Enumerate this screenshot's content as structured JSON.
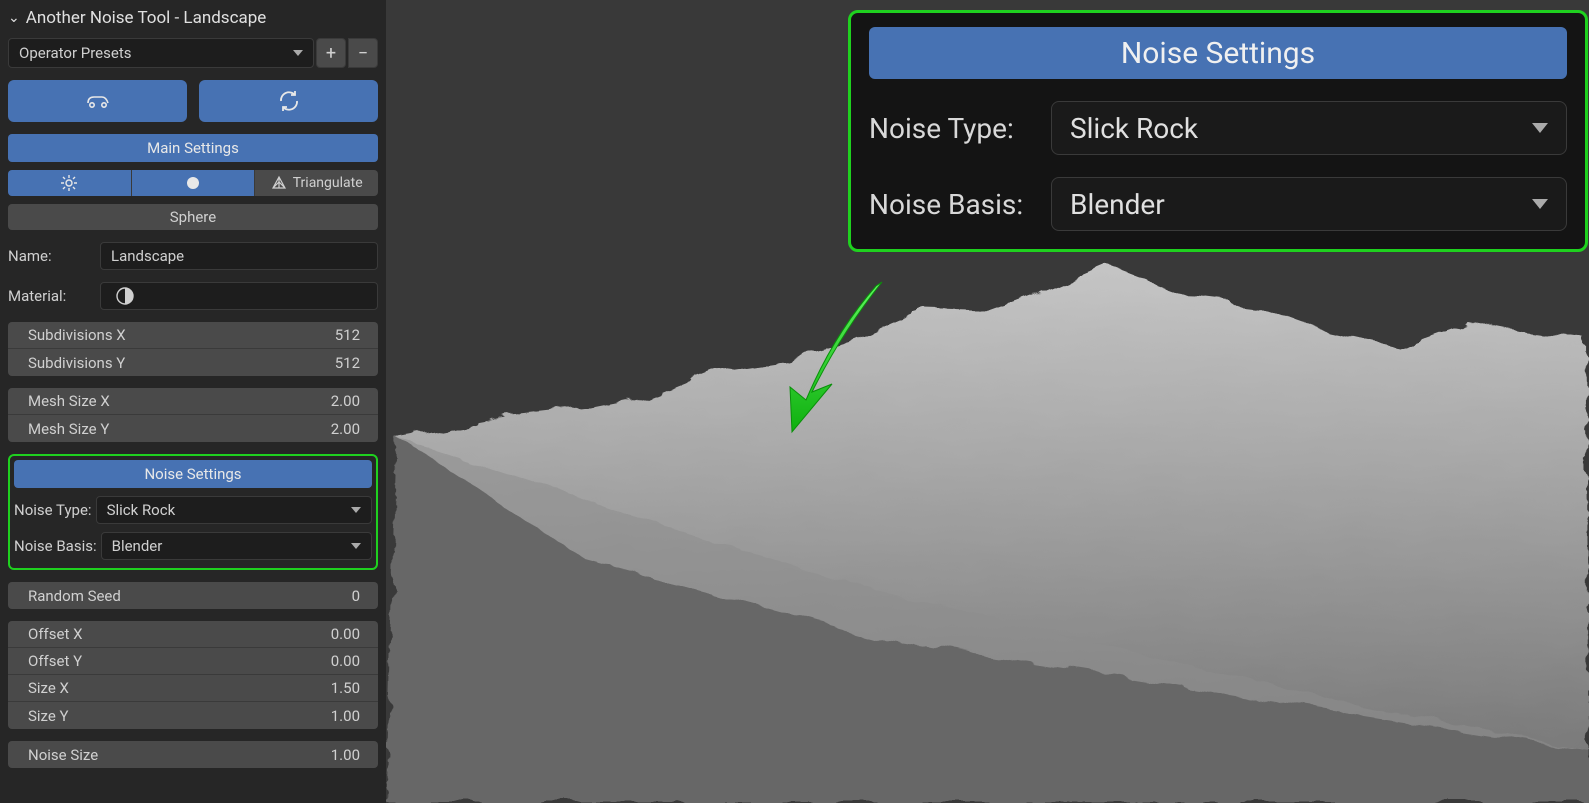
{
  "panel": {
    "title": "Another Noise Tool - Landscape"
  },
  "presets": {
    "label": "Operator Presets",
    "add": "+",
    "remove": "−"
  },
  "main": {
    "header": "Main Settings",
    "triangulate": "Triangulate",
    "sphere": "Sphere",
    "name_label": "Name:",
    "name_value": "Landscape",
    "material_label": "Material:"
  },
  "subdiv": {
    "x_label": "Subdivisions X",
    "x_value": "512",
    "y_label": "Subdivisions Y",
    "y_value": "512"
  },
  "mesh": {
    "x_label": "Mesh Size X",
    "x_value": "2.00",
    "y_label": "Mesh Size Y",
    "y_value": "2.00"
  },
  "noise": {
    "header": "Noise Settings",
    "type_label": "Noise Type:",
    "type_value": "Slick Rock",
    "basis_label": "Noise Basis:",
    "basis_value": "Blender"
  },
  "seed": {
    "label": "Random Seed",
    "value": "0"
  },
  "offset": {
    "x_label": "Offset X",
    "x_value": "0.00",
    "y_label": "Offset Y",
    "y_value": "0.00",
    "sx_label": "Size X",
    "sx_value": "1.50",
    "sy_label": "Size Y",
    "sy_value": "1.00"
  },
  "nsize": {
    "label": "Noise Size",
    "value": "1.00"
  },
  "callout": {
    "header": "Noise Settings",
    "type_label": "Noise Type:",
    "type_value": "Slick Rock",
    "basis_label": "Noise Basis:",
    "basis_value": "Blender"
  }
}
